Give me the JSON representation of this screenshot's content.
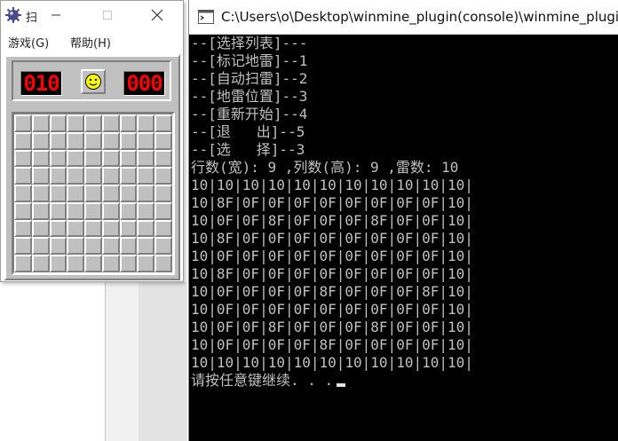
{
  "minesweeper": {
    "title": "扫",
    "menus": [
      "游戏(G)",
      "帮助(H)"
    ],
    "mine_counter": "010",
    "time_counter": "000",
    "grid_rows": 9,
    "grid_cols": 9,
    "colors": {
      "face": "#c0c0c0",
      "digits": "#ff0000",
      "smiley": "#ffff00"
    }
  },
  "console": {
    "title": "C:\\Users\\o\\Desktop\\winmine_plugin(console)\\winmine_plugin",
    "lines": [
      "--[选择列表]---",
      "--[标记地雷]--1",
      "--[自动扫雷]--2",
      "--[地雷位置]--3",
      "--[重新开始]--4",
      "--[退   出]--5",
      "--[选   择]--3",
      "行数(宽): 9 ,列数(高): 9 ,雷数: 10",
      "10|10|10|10|10|10|10|10|10|10|10|",
      "10|8F|0F|0F|0F|0F|0F|0F|0F|0F|10|",
      "10|0F|0F|8F|0F|0F|0F|8F|0F|0F|10|",
      "10|8F|0F|0F|0F|0F|0F|0F|0F|0F|10|",
      "10|0F|0F|0F|0F|0F|0F|0F|0F|0F|10|",
      "10|8F|0F|0F|0F|0F|0F|0F|0F|0F|10|",
      "10|0F|0F|0F|0F|8F|0F|0F|0F|8F|10|",
      "10|0F|0F|0F|0F|0F|0F|0F|0F|0F|10|",
      "10|0F|0F|8F|0F|0F|0F|8F|0F|0F|10|",
      "10|0F|0F|0F|0F|8F|0F|0F|0F|0F|10|",
      "10|10|10|10|10|10|10|10|10|10|10|",
      "请按任意键继续. . ."
    ],
    "colors": {
      "background": "#000000",
      "text": "#c0c0c0"
    }
  }
}
